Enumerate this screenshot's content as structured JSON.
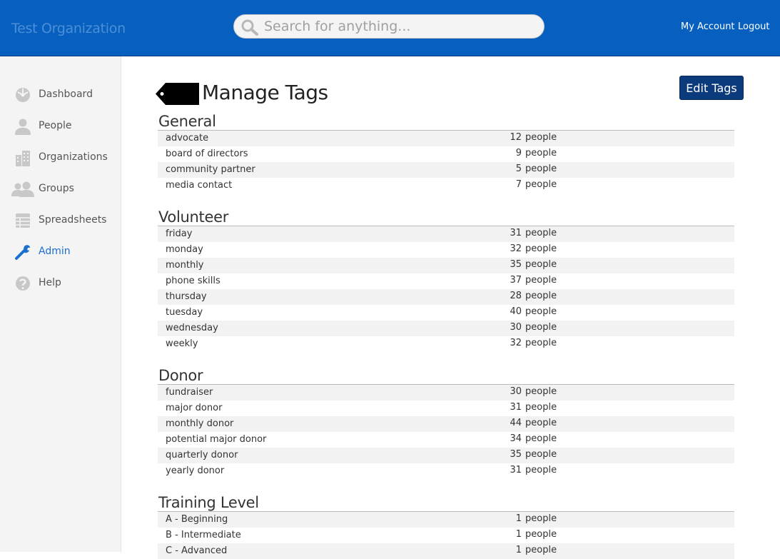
{
  "header": {
    "org_name": "Test Organization",
    "search_placeholder": "Search for anything...",
    "my_account": "My Account",
    "logout": "Logout"
  },
  "sidebar": {
    "items": [
      {
        "label": "Dashboard",
        "icon": "dashboard-icon"
      },
      {
        "label": "People",
        "icon": "person-icon"
      },
      {
        "label": "Organizations",
        "icon": "building-icon"
      },
      {
        "label": "Groups",
        "icon": "group-icon"
      },
      {
        "label": "Spreadsheets",
        "icon": "spreadsheet-icon"
      },
      {
        "label": "Admin",
        "icon": "wrench-icon",
        "active": true
      },
      {
        "label": "Help",
        "icon": "help-icon"
      }
    ]
  },
  "main": {
    "title": "Manage Tags",
    "edit_button": "Edit Tags",
    "sections": [
      {
        "title": "General",
        "rows": [
          {
            "name": "advocate",
            "count": "12",
            "unit": "people"
          },
          {
            "name": "board of directors",
            "count": "9",
            "unit": "people"
          },
          {
            "name": "community partner",
            "count": "5",
            "unit": "people"
          },
          {
            "name": "media contact",
            "count": "7",
            "unit": "people"
          }
        ]
      },
      {
        "title": "Volunteer",
        "rows": [
          {
            "name": "friday",
            "count": "31",
            "unit": "people"
          },
          {
            "name": "monday",
            "count": "32",
            "unit": "people"
          },
          {
            "name": "monthly",
            "count": "35",
            "unit": "people"
          },
          {
            "name": "phone skills",
            "count": "37",
            "unit": "people"
          },
          {
            "name": "thursday",
            "count": "28",
            "unit": "people"
          },
          {
            "name": "tuesday",
            "count": "40",
            "unit": "people"
          },
          {
            "name": "wednesday",
            "count": "30",
            "unit": "people"
          },
          {
            "name": "weekly",
            "count": "32",
            "unit": "people"
          }
        ]
      },
      {
        "title": "Donor",
        "rows": [
          {
            "name": "fundraiser",
            "count": "30",
            "unit": "people"
          },
          {
            "name": "major donor",
            "count": "31",
            "unit": "people"
          },
          {
            "name": "monthly donor",
            "count": "44",
            "unit": "people"
          },
          {
            "name": "potential major donor",
            "count": "34",
            "unit": "people"
          },
          {
            "name": "quarterly donor",
            "count": "35",
            "unit": "people"
          },
          {
            "name": "yearly donor",
            "count": "31",
            "unit": "people"
          }
        ]
      },
      {
        "title": "Training Level",
        "rows": [
          {
            "name": "A - Beginning",
            "count": "1",
            "unit": "people"
          },
          {
            "name": "B - Intermediate",
            "count": "1",
            "unit": "people"
          },
          {
            "name": "C - Advanced",
            "count": "1",
            "unit": "people"
          }
        ]
      }
    ]
  },
  "colors": {
    "header_bg": "#0760c0",
    "edit_button_bg": "#0b3b7d",
    "active_nav": "#1a6fcf"
  }
}
